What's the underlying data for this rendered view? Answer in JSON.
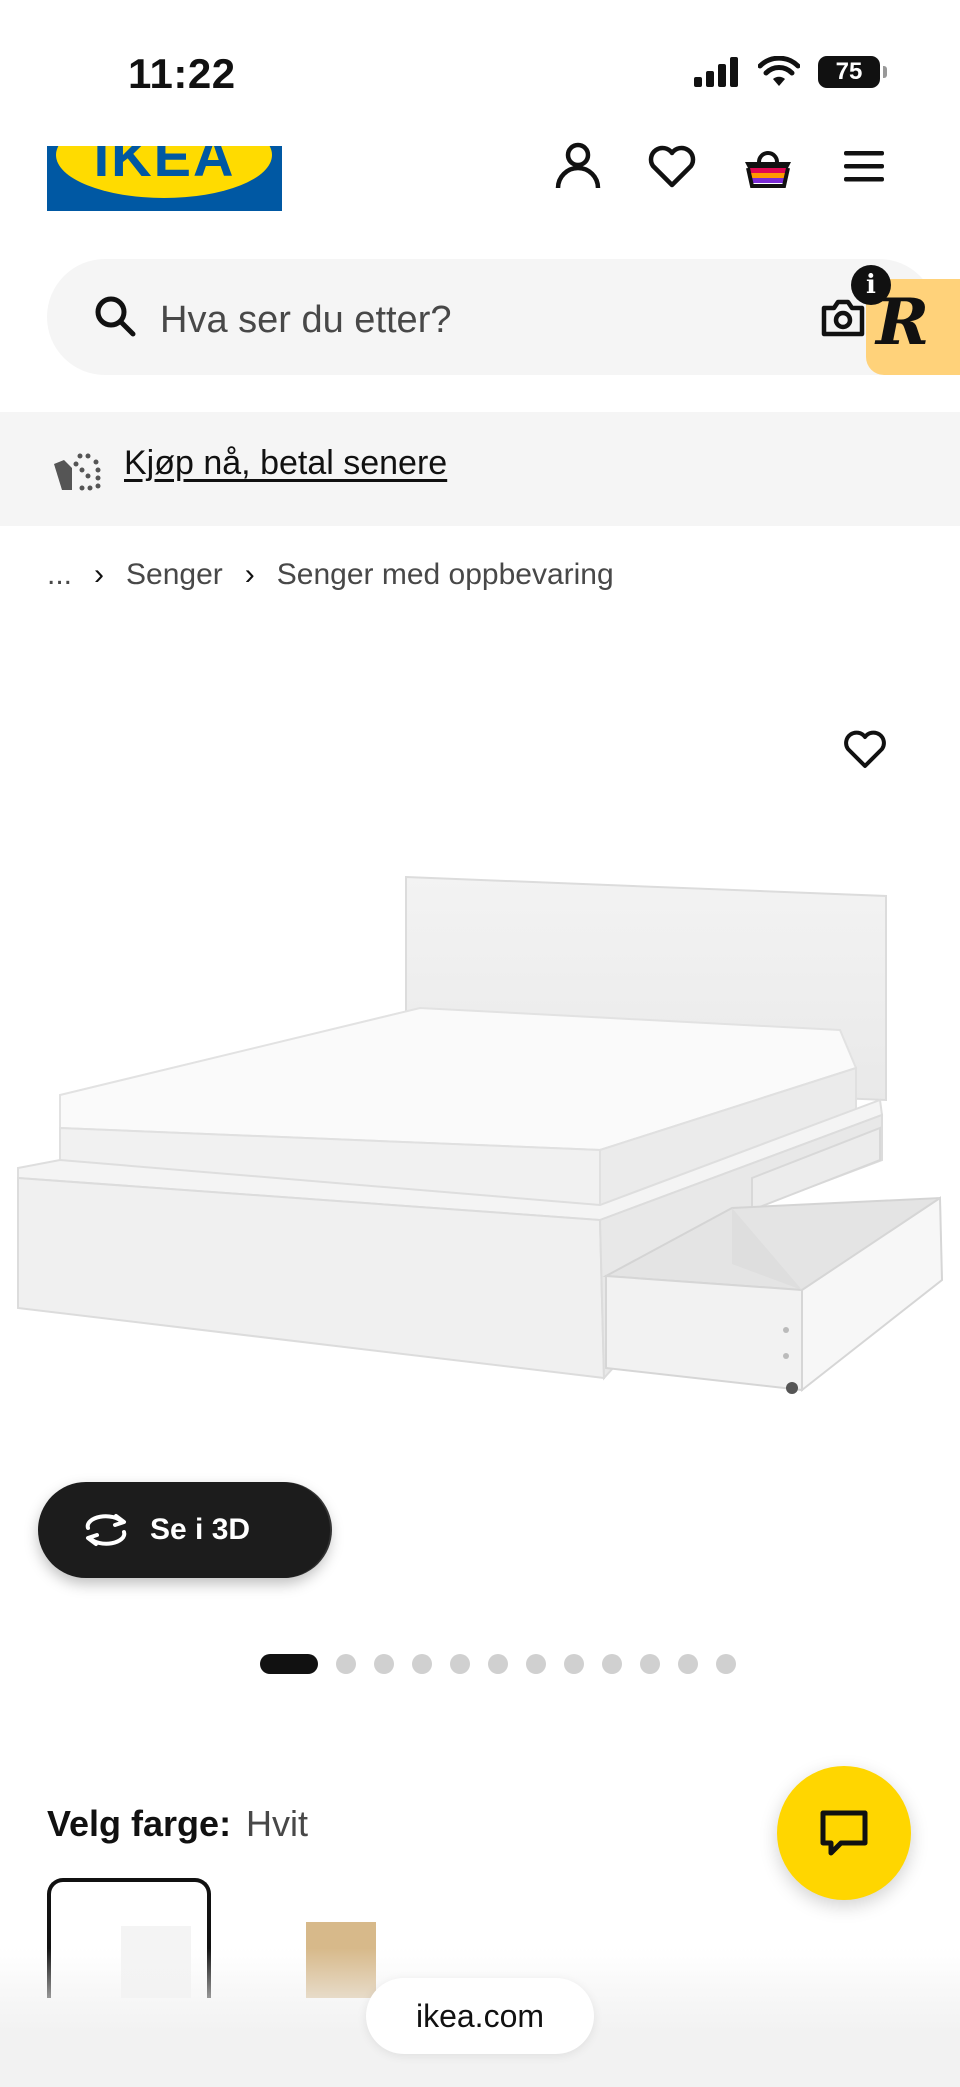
{
  "status_bar": {
    "time": "11:22",
    "battery": "75"
  },
  "header": {
    "logo_text": "IKEA"
  },
  "search": {
    "placeholder": "Hva ser du etter?"
  },
  "promo": {
    "link": "Kjøp nå, betal senere"
  },
  "breadcrumb": {
    "ellipsis": "...",
    "items": [
      "Senger",
      "Senger med oppbevaring"
    ]
  },
  "product": {
    "view_3d_label": "Se i 3D",
    "image_count": 12,
    "active_image": 1
  },
  "color": {
    "label": "Velg farge:",
    "value": "Hvit",
    "swatches": [
      "white",
      "oak"
    ]
  },
  "browser": {
    "url": "ikea.com"
  },
  "colors": {
    "brand_blue": "#0058a3",
    "brand_yellow": "#ffdb00",
    "chat_yellow": "#ffd600"
  }
}
